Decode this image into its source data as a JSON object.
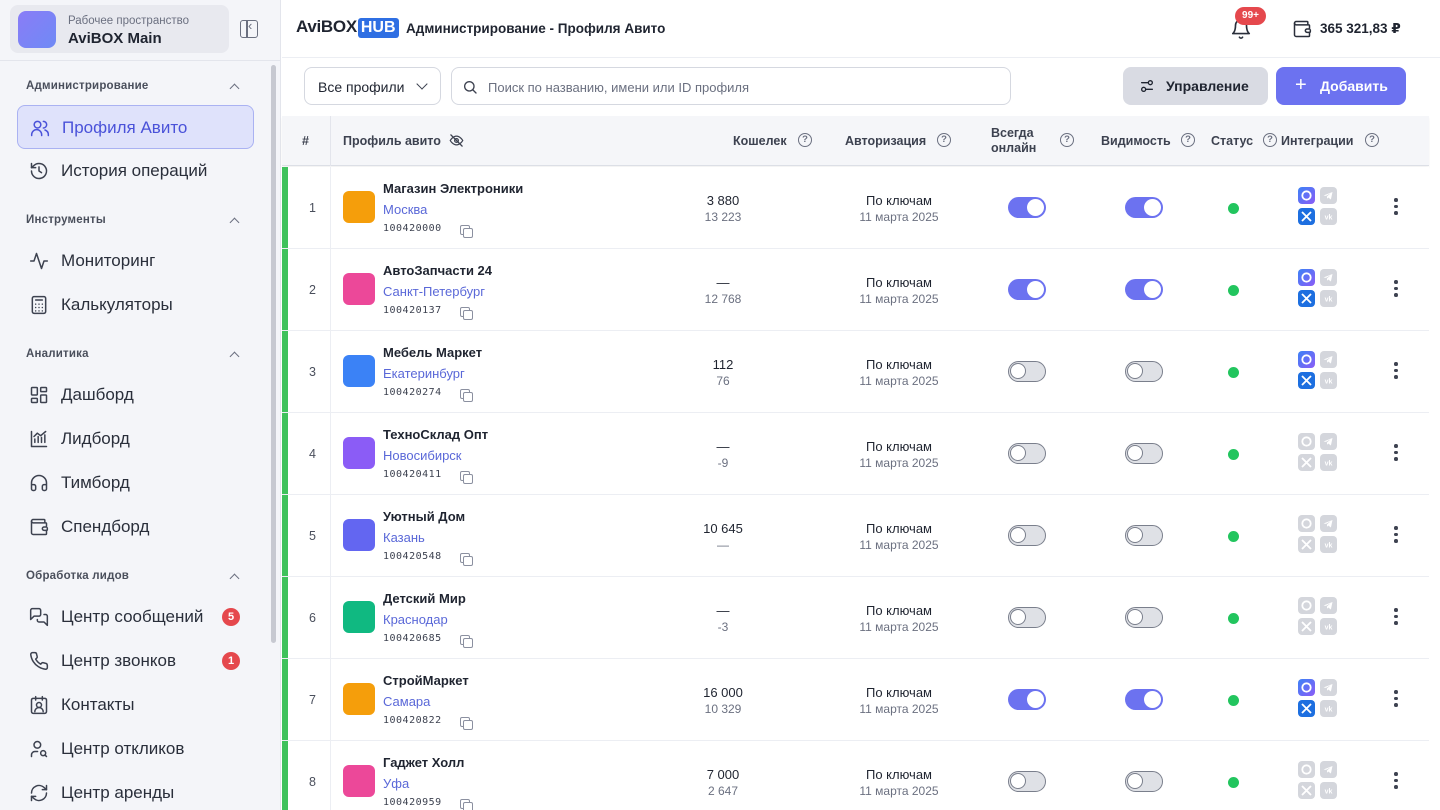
{
  "workspace": {
    "subtitle": "Рабочее пространство",
    "name": "AviBOX Main"
  },
  "sidebar": {
    "sections": [
      {
        "title": "Администрирование",
        "items": [
          {
            "label": "Профиля Авито",
            "icon": "users-icon",
            "active": true
          },
          {
            "label": "История операций",
            "icon": "history-icon"
          }
        ]
      },
      {
        "title": "Инструменты",
        "items": [
          {
            "label": "Мониторинг",
            "icon": "activity-icon"
          },
          {
            "label": "Калькуляторы",
            "icon": "calculator-icon"
          }
        ]
      },
      {
        "title": "Аналитика",
        "items": [
          {
            "label": "Дашборд",
            "icon": "dashboard-icon"
          },
          {
            "label": "Лидборд",
            "icon": "bar-chart-icon"
          },
          {
            "label": "Тимборд",
            "icon": "headphones-icon"
          },
          {
            "label": "Спендборд",
            "icon": "wallet-icon"
          }
        ]
      },
      {
        "title": "Обработка лидов",
        "items": [
          {
            "label": "Центр сообщений",
            "icon": "messages-icon",
            "badge": "5"
          },
          {
            "label": "Центр звонков",
            "icon": "phone-icon",
            "badge": "1"
          },
          {
            "label": "Контакты",
            "icon": "contacts-icon"
          },
          {
            "label": "Центр откликов",
            "icon": "user-search-icon"
          },
          {
            "label": "Центр аренды",
            "icon": "refresh-icon"
          }
        ]
      }
    ]
  },
  "header": {
    "brand_left": "AviBOX",
    "brand_right": "HUB",
    "title": "Администрирование - Профиля Авито",
    "notifications": "99+",
    "balance": "365 321,83 ₽"
  },
  "toolbar": {
    "filter": "Все профили",
    "search_placeholder": "Поиск по названию, имени или ID профиля",
    "manage": "Управление",
    "add": "Добавить"
  },
  "table": {
    "columns": {
      "num": "#",
      "profile": "Профиль авито",
      "wallet": "Кошелек",
      "auth": "Авторизация",
      "online_1": "Всегда",
      "online_2": "онлайн",
      "visibility": "Видимость",
      "status": "Статус",
      "integrations": "Интеграции"
    },
    "rows": [
      {
        "n": "1",
        "name": "Магазин Электроники",
        "city": "Москва",
        "id": "100420000",
        "w1": "3 880",
        "w2": "13 223",
        "auth": "По ключам",
        "date": "11 марта 2025",
        "online": true,
        "visible": true,
        "integ_active": true,
        "color": "#f59e0b"
      },
      {
        "n": "2",
        "name": "АвтоЗапчасти 24",
        "city": "Санкт-Петербург",
        "id": "100420137",
        "w1": "—",
        "w2": "12 768",
        "auth": "По ключам",
        "date": "11 марта 2025",
        "online": true,
        "visible": true,
        "integ_active": true,
        "color": "#ec4899"
      },
      {
        "n": "3",
        "name": "Мебель Маркет",
        "city": "Екатеринбург",
        "id": "100420274",
        "w1": "112",
        "w2": "76",
        "auth": "По ключам",
        "date": "11 марта 2025",
        "online": false,
        "visible": false,
        "integ_active": true,
        "color": "#3b82f6"
      },
      {
        "n": "4",
        "name": "ТехноСклад Опт",
        "city": "Новосибирск",
        "id": "100420411",
        "w1": "—",
        "w2": "-9",
        "auth": "По ключам",
        "date": "11 марта 2025",
        "online": false,
        "visible": false,
        "integ_active": false,
        "color": "#8b5cf6"
      },
      {
        "n": "5",
        "name": "Уютный Дом",
        "city": "Казань",
        "id": "100420548",
        "w1": "10 645",
        "w2": "—",
        "auth": "По ключам",
        "date": "11 марта 2025",
        "online": false,
        "visible": false,
        "integ_active": false,
        "color": "#6366f1"
      },
      {
        "n": "6",
        "name": "Детский Мир",
        "city": "Краснодар",
        "id": "100420685",
        "w1": "—",
        "w2": "-3",
        "auth": "По ключам",
        "date": "11 марта 2025",
        "online": false,
        "visible": false,
        "integ_active": false,
        "color": "#10b981"
      },
      {
        "n": "7",
        "name": "СтройМаркет",
        "city": "Самара",
        "id": "100420822",
        "w1": "16 000",
        "w2": "10 329",
        "auth": "По ключам",
        "date": "11 марта 2025",
        "online": true,
        "visible": true,
        "integ_active": true,
        "color": "#f59e0b"
      },
      {
        "n": "8",
        "name": "Гаджет Холл",
        "city": "Уфа",
        "id": "100420959",
        "w1": "7 000",
        "w2": "2 647",
        "auth": "По ключам",
        "date": "11 марта 2025",
        "online": false,
        "visible": false,
        "integ_active": false,
        "color": "#ec4899"
      }
    ]
  },
  "colors": {
    "accent": "#6c72f0",
    "status_green": "#22c55e",
    "row_accent": "#3fc25c",
    "badge_red": "#e5484d"
  }
}
